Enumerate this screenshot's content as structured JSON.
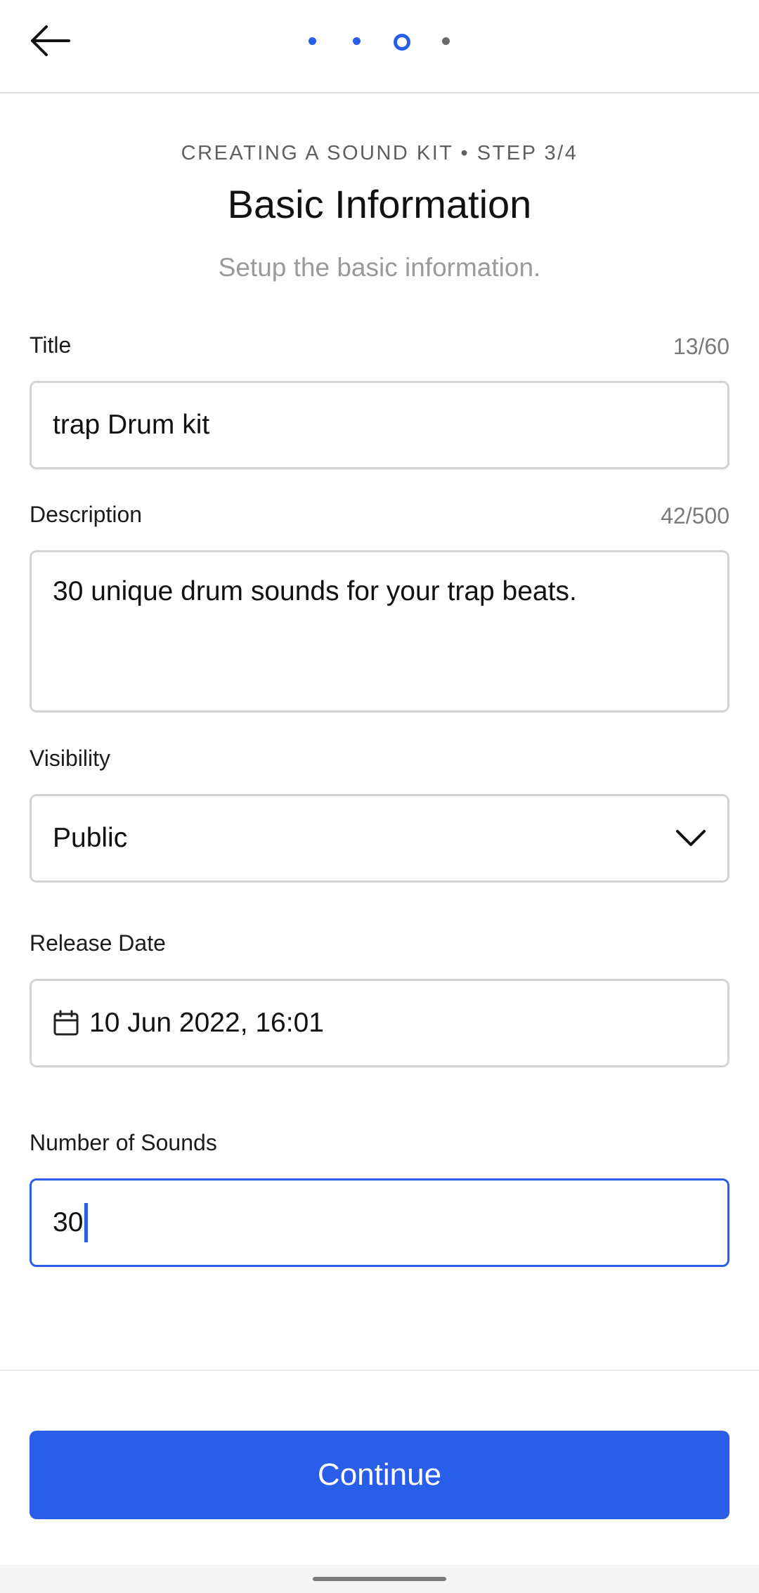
{
  "theme": {
    "accent": "#2a5ee8"
  },
  "header": {
    "back_icon": "arrow-left-icon",
    "progress": {
      "total_steps": 4,
      "current_step": 3
    }
  },
  "intro": {
    "step_caption": "CREATING A SOUND KIT • STEP 3/4",
    "title": "Basic Information",
    "subtitle": "Setup the basic information."
  },
  "form": {
    "title": {
      "label": "Title",
      "counter": "13/60",
      "value": "trap Drum kit"
    },
    "description": {
      "label": "Description",
      "counter": "42/500",
      "value": "30 unique drum sounds for your trap beats."
    },
    "visibility": {
      "label": "Visibility",
      "value": "Public",
      "icon": "chevron-down-icon"
    },
    "release_date": {
      "label": "Release Date",
      "value": "10 Jun 2022, 16:01",
      "icon": "calendar-icon"
    },
    "number_of_sounds": {
      "label": "Number of Sounds",
      "value": "30"
    }
  },
  "footer": {
    "continue_label": "Continue"
  }
}
